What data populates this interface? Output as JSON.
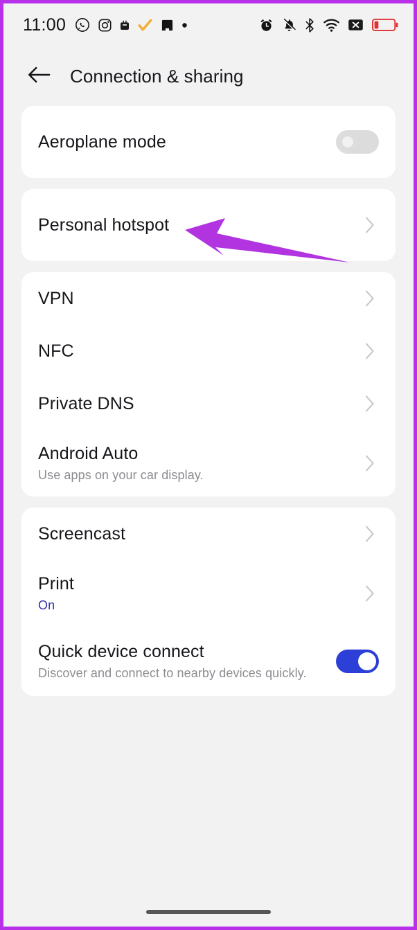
{
  "status_bar": {
    "time": "11:00",
    "left_icons": [
      "whatsapp-icon",
      "instagram-icon",
      "app-badge-icon",
      "checkmark-icon",
      "app-dark-icon",
      "dot-icon"
    ],
    "right_icons": [
      "alarm-icon",
      "bell-muted-icon",
      "bluetooth-icon",
      "wifi-icon",
      "no-sim-icon",
      "battery-low-icon"
    ]
  },
  "header": {
    "back_icon": "arrow-left-icon",
    "title": "Connection & sharing"
  },
  "colors": {
    "accent_blue": "#2c3fd6",
    "link_blue": "#3434a8",
    "annotation_purple": "#b134e0",
    "page_background": "#f2f2f3",
    "card_background": "#ffffff",
    "chevron_grey": "#c9c9cd"
  },
  "cards": [
    {
      "id": "airplane-card",
      "rows": [
        {
          "name": "aeroplane-mode",
          "title": "Aeroplane mode",
          "subtitle": "",
          "control": "toggle",
          "toggle_state": "off"
        }
      ]
    },
    {
      "id": "hotspot-card",
      "rows": [
        {
          "name": "personal-hotspot",
          "title": "Personal hotspot",
          "subtitle": "",
          "control": "chevron",
          "toggle_state": ""
        }
      ]
    },
    {
      "id": "network-card",
      "rows": [
        {
          "name": "vpn",
          "title": "VPN",
          "subtitle": "",
          "control": "chevron",
          "toggle_state": ""
        },
        {
          "name": "nfc",
          "title": "NFC",
          "subtitle": "",
          "control": "chevron",
          "toggle_state": ""
        },
        {
          "name": "private-dns",
          "title": "Private DNS",
          "subtitle": "",
          "control": "chevron",
          "toggle_state": ""
        },
        {
          "name": "android-auto",
          "title": "Android Auto",
          "subtitle": "Use apps on your car display.",
          "control": "chevron",
          "toggle_state": ""
        }
      ]
    },
    {
      "id": "sharing-card",
      "rows": [
        {
          "name": "screencast",
          "title": "Screencast",
          "subtitle": "",
          "control": "chevron",
          "toggle_state": ""
        },
        {
          "name": "print",
          "title": "Print",
          "subtitle": "On",
          "subtitle_style": "accent",
          "control": "chevron",
          "toggle_state": ""
        },
        {
          "name": "quick-device-connect",
          "title": "Quick device connect",
          "subtitle": "Discover and connect to nearby devices quickly.",
          "control": "toggle",
          "toggle_state": "on"
        }
      ]
    }
  ],
  "annotation": {
    "type": "arrow",
    "points_to": "personal-hotspot",
    "color": "#b134e0"
  },
  "navigation": {
    "home_indicator": "home-bar"
  }
}
